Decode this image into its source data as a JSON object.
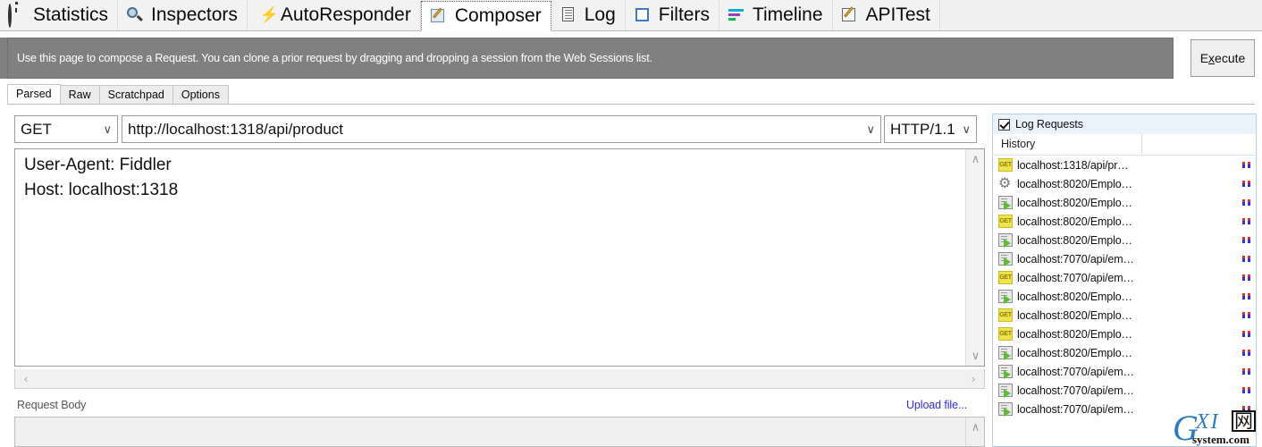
{
  "top_tabs": [
    {
      "label": "Statistics",
      "icon": "stopwatch-icon",
      "selected": false
    },
    {
      "label": "Inspectors",
      "icon": "magnifier-icon",
      "selected": false
    },
    {
      "label": "AutoResponder",
      "icon": "lightning-bolt-icon",
      "selected": false
    },
    {
      "label": "Composer",
      "icon": "compose-pencil-icon",
      "selected": true
    },
    {
      "label": "Log",
      "icon": "document-icon",
      "selected": false
    },
    {
      "label": "Filters",
      "icon": "square-outline-icon",
      "selected": false
    },
    {
      "label": "Timeline",
      "icon": "bars-icon",
      "selected": false
    },
    {
      "label": "APITest",
      "icon": "pencil-pad-icon",
      "selected": false
    }
  ],
  "infobar": {
    "text": "Use this page to compose a Request. You can clone a prior request by dragging and dropping a session from the Web Sessions list.",
    "background": "#808080"
  },
  "execute": {
    "prefix": "E",
    "accel": "x",
    "suffix": "ecute"
  },
  "sub_tabs": [
    {
      "label": "Parsed",
      "selected": true
    },
    {
      "label": "Raw",
      "selected": false
    },
    {
      "label": "Scratchpad",
      "selected": false
    },
    {
      "label": "Options",
      "selected": false
    }
  ],
  "request": {
    "method": "GET",
    "url": "http://localhost:1318/api/product",
    "http_version": "HTTP/1.1",
    "headers": "User-Agent: Fiddler\nHost: localhost:1318",
    "body_label": "Request Body",
    "upload_link": "Upload file...",
    "body_value": ""
  },
  "history_panel": {
    "log_requests_label": "Log Requests",
    "log_requests_checked": true,
    "column_header": "History",
    "items": [
      {
        "icon": "get-tag-icon",
        "label": "localhost:1318/api/pr…"
      },
      {
        "icon": "gear-icon",
        "label": "localhost:8020/Emplo…"
      },
      {
        "icon": "page-arrow-icon",
        "label": "localhost:8020/Emplo…"
      },
      {
        "icon": "get-tag-icon",
        "label": "localhost:8020/Emplo…"
      },
      {
        "icon": "page-arrow-icon",
        "label": "localhost:8020/Emplo…"
      },
      {
        "icon": "page-arrow-icon",
        "label": "localhost:7070/api/em…"
      },
      {
        "icon": "get-tag-icon",
        "label": "localhost:7070/api/em…"
      },
      {
        "icon": "page-arrow-icon",
        "label": "localhost:8020/Emplo…"
      },
      {
        "icon": "get-tag-icon",
        "label": "localhost:8020/Emplo…"
      },
      {
        "icon": "get-tag-icon",
        "label": "localhost:8020/Emplo…"
      },
      {
        "icon": "page-arrow-icon",
        "label": "localhost:8020/Emplo…"
      },
      {
        "icon": "page-arrow-icon",
        "label": "localhost:7070/api/em…"
      },
      {
        "icon": "page-arrow-icon",
        "label": "localhost:7070/api/em…"
      },
      {
        "icon": "page-arrow-icon",
        "label": "localhost:7070/api/em…"
      }
    ],
    "get_tag_text": "GET"
  },
  "watermark": {
    "g": "G",
    "xi": "XI",
    "cn": "网",
    "sys": "system.com"
  },
  "scroll": {
    "up": "∧",
    "down": "∨",
    "left": "‹",
    "right": "›",
    "chevron": "∨"
  }
}
